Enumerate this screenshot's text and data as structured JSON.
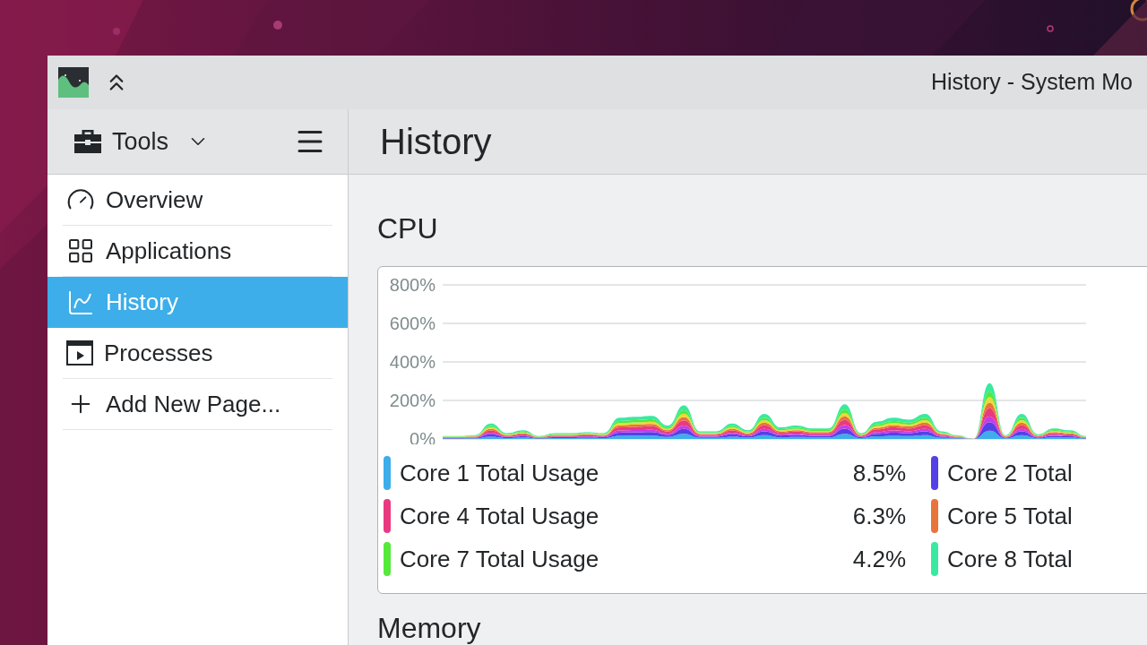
{
  "window": {
    "title": "History - System Mo"
  },
  "sidebar": {
    "menu_label": "Tools",
    "items": [
      {
        "label": "Overview",
        "selected": false
      },
      {
        "label": "Applications",
        "selected": false
      },
      {
        "label": "History",
        "selected": true
      },
      {
        "label": "Processes",
        "selected": false
      },
      {
        "label": "Add New Page...",
        "selected": false
      }
    ]
  },
  "page": {
    "title": "History"
  },
  "cpu": {
    "heading": "CPU",
    "y_axis_labels": [
      "800%",
      "600%",
      "400%",
      "200%",
      "0%"
    ],
    "legend": [
      {
        "label": "Core 1 Total Usage",
        "value": "8.5%",
        "color": "#3daee9"
      },
      {
        "label": "Core 2 Total",
        "color": "#5340e6"
      },
      {
        "label": "Core 4 Total Usage",
        "value": "6.3%",
        "color": "#e93a7f"
      },
      {
        "label": "Core 5 Total",
        "color": "#e9743a"
      },
      {
        "label": "Core 7 Total Usage",
        "value": "4.2%",
        "color": "#55e93a"
      },
      {
        "label": "Core 8 Total",
        "color": "#3ae9a0"
      }
    ]
  },
  "memory": {
    "heading": "Memory"
  }
}
